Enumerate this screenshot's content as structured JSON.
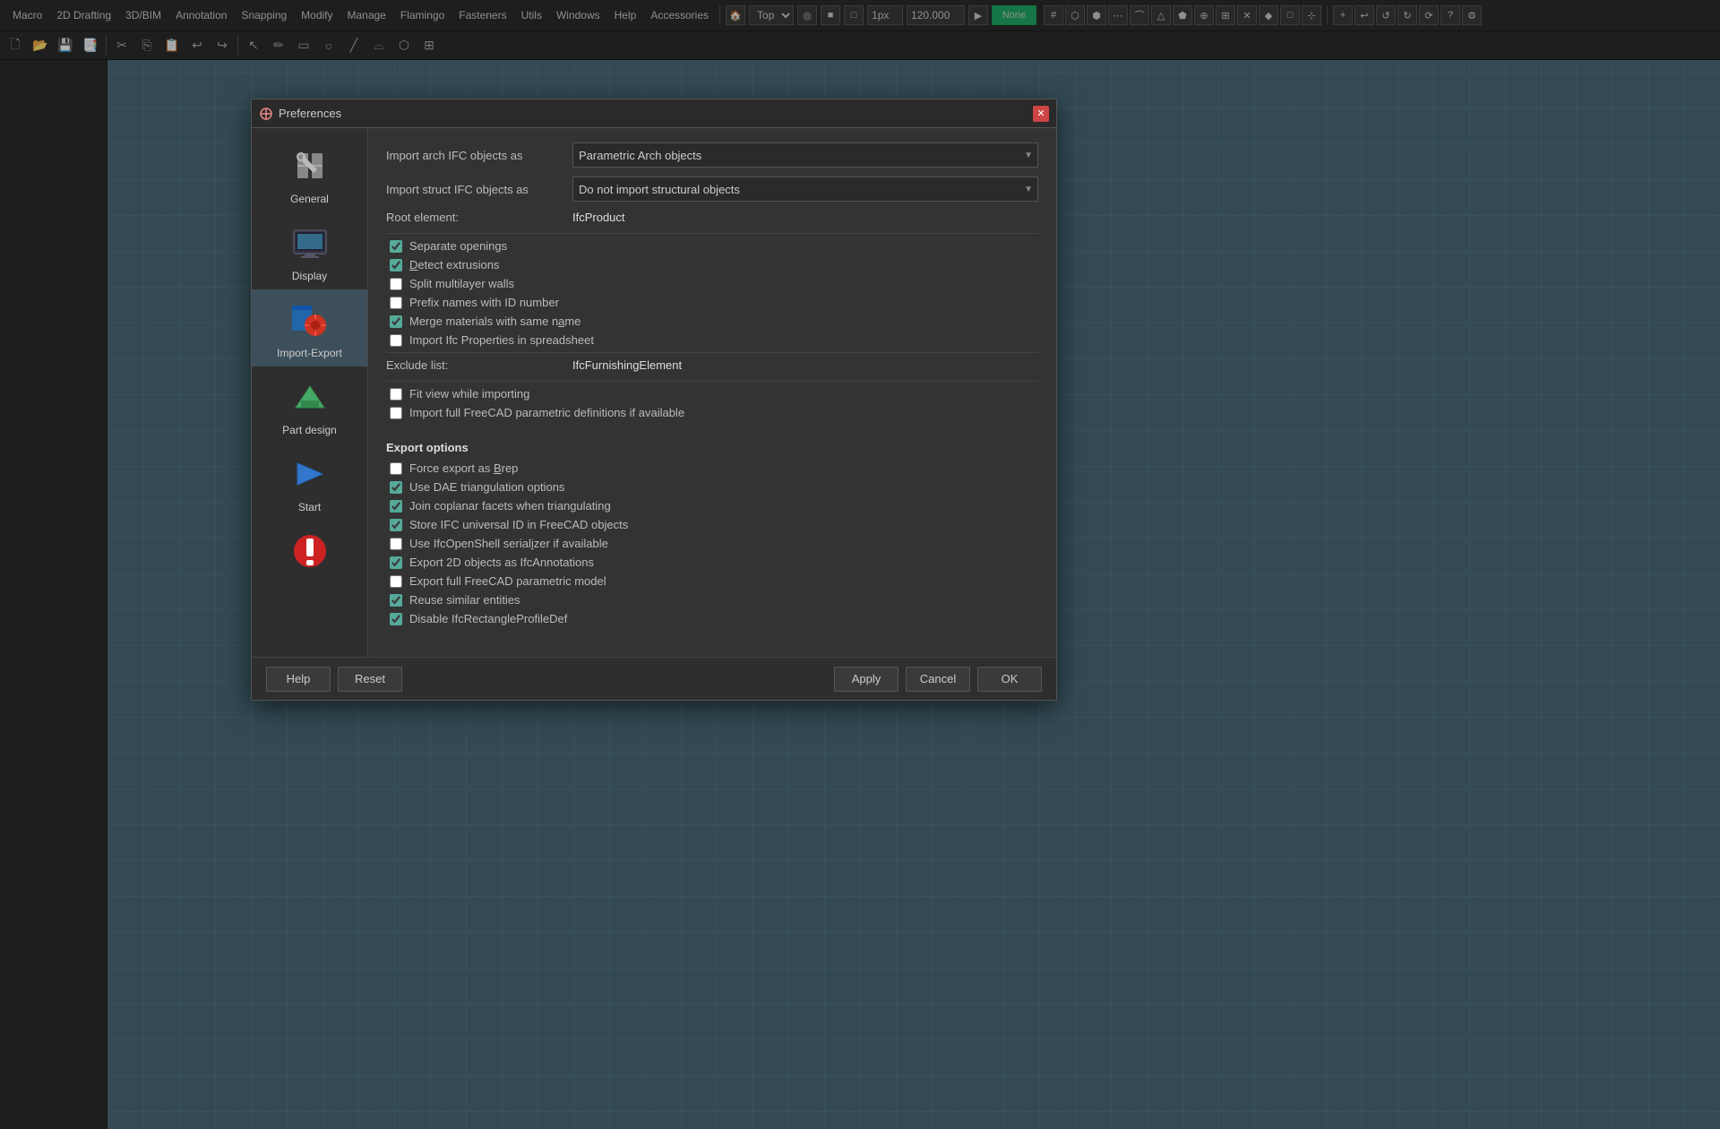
{
  "topbar": {
    "view_label": "Top",
    "toolbar_items": [
      "Macro",
      "2D Drafting",
      "3D/BIM",
      "Annotation",
      "Snapping",
      "Modify",
      "Manage",
      "Flamingo",
      "Fasteners",
      "Utils",
      "Windows",
      "Help",
      "Accessories"
    ]
  },
  "dialog": {
    "title": "Preferences",
    "sidebar": {
      "items": [
        {
          "id": "general",
          "label": "General"
        },
        {
          "id": "display",
          "label": "Display"
        },
        {
          "id": "import-export",
          "label": "Import-Export",
          "active": true
        },
        {
          "id": "part-design",
          "label": "Part design"
        },
        {
          "id": "start",
          "label": "Start"
        }
      ]
    },
    "content": {
      "import_arch_label": "Import arch IFC objects as",
      "import_arch_value": "Parametric Arch objects",
      "import_struct_label": "Import struct IFC objects as",
      "import_struct_value": "Do not import structural objects",
      "root_element_label": "Root element:",
      "root_element_value": "IfcProduct",
      "checkboxes": [
        {
          "id": "separate_openings",
          "checked": true,
          "label": "Separate openings"
        },
        {
          "id": "detect_extrusions",
          "checked": true,
          "label": "Detect extrusions"
        },
        {
          "id": "split_multilayer",
          "checked": false,
          "label": "Split multilayer walls"
        },
        {
          "id": "prefix_names",
          "checked": false,
          "label": "Prefix names with ID number"
        },
        {
          "id": "merge_materials",
          "checked": true,
          "label": "Merge materials with same name"
        },
        {
          "id": "import_ifc_props",
          "checked": false,
          "label": "Import Ifc Properties in spreadsheet"
        }
      ],
      "exclude_label": "Exclude list:",
      "exclude_value": "IfcFurnishingElement",
      "more_checkboxes": [
        {
          "id": "fit_view",
          "checked": false,
          "label": "Fit view while importing"
        },
        {
          "id": "import_full",
          "checked": false,
          "label": "Import full FreeCAD parametric definitions if available"
        }
      ],
      "export_section": "Export options",
      "export_checkboxes": [
        {
          "id": "force_export_brep",
          "checked": false,
          "label": "Force export as Brep"
        },
        {
          "id": "use_dae_triangulation",
          "checked": true,
          "label": "Use DAE triangulation options"
        },
        {
          "id": "join_coplanar",
          "checked": true,
          "label": "Join coplanar facets when triangulating"
        },
        {
          "id": "store_ifc_universal",
          "checked": true,
          "label": "Store IFC universal ID in FreeCAD objects"
        },
        {
          "id": "use_ifcopenShell",
          "checked": false,
          "label": "Use IfcOpenShell serializer if available"
        },
        {
          "id": "export_2d",
          "checked": true,
          "label": "Export 2D objects as IfcAnnotations"
        },
        {
          "id": "export_full_freecad",
          "checked": false,
          "label": "Export full FreeCAD parametric model"
        },
        {
          "id": "reuse_similar",
          "checked": true,
          "label": "Reuse similar entities"
        },
        {
          "id": "disable_ifc_rect",
          "checked": true,
          "label": "Disable IfcRectangleProfileDef"
        }
      ]
    },
    "footer": {
      "help_label": "Help",
      "reset_label": "Reset",
      "apply_label": "Apply",
      "cancel_label": "Cancel",
      "ok_label": "OK"
    }
  }
}
